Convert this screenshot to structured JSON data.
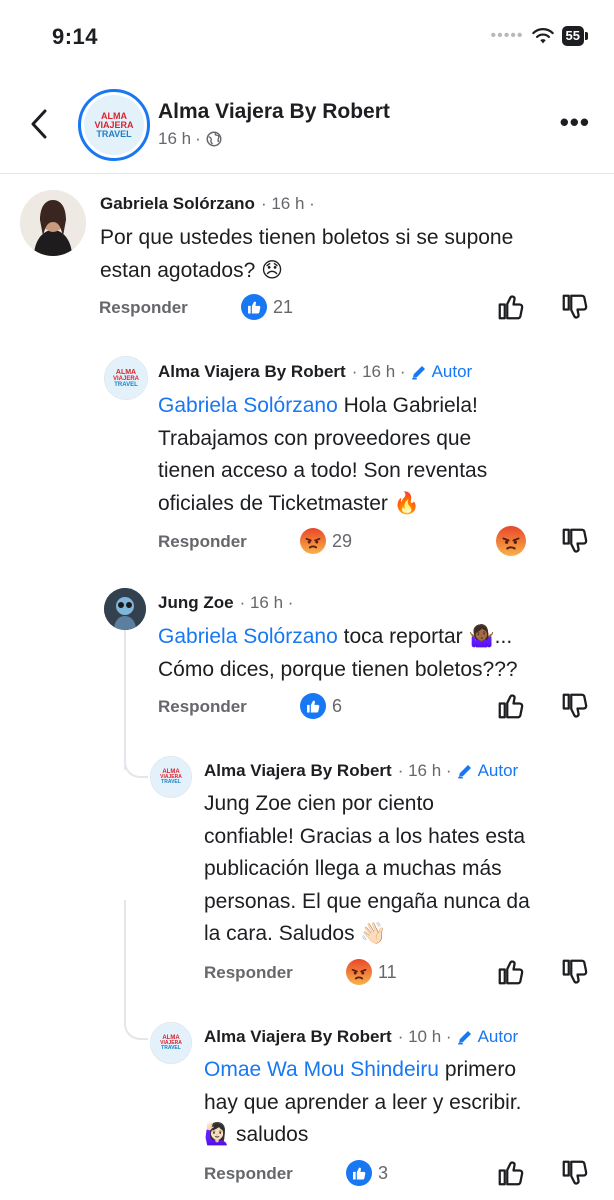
{
  "status_bar": {
    "time": "9:14",
    "battery": "55"
  },
  "header": {
    "title": "Alma Viajera By Robert",
    "time": "16 h",
    "separator": "·"
  },
  "logo": {
    "line1": "ALMA",
    "line2": "VIAJERA",
    "line3": "TRAVEL"
  },
  "comments": [
    {
      "author": "Gabriela Solórzano",
      "meta": "· 16 h ·",
      "text_lines": [
        "Por que ustedes tienen boletos si se supone",
        "estan agotados? 😞"
      ],
      "reply_label": "Responder",
      "reaction_count": "21",
      "reaction_type": "like"
    },
    {
      "author": "Alma Viajera By Robert",
      "meta": "· 16 h ·",
      "badge": "Autor",
      "mention": "Gabriela Solórzano",
      "text_lines": [
        " Hola Gabriela!",
        "Trabajamos con proveedores que",
        "tienen acceso a todo! Son reventas",
        "oficiales de Ticketmaster 🔥"
      ],
      "reply_label": "Responder",
      "reaction_count": "29",
      "reaction_type": "angry"
    },
    {
      "author": "Jung Zoe",
      "meta": "· 16 h ·",
      "mention": "Gabriela Solórzano",
      "text_lines": [
        " toca reportar 🤷🏾‍♀️...",
        "Cómo dices, porque tienen boletos???"
      ],
      "reply_label": "Responder",
      "reaction_count": "6",
      "reaction_type": "like"
    },
    {
      "author": "Alma Viajera By Robert",
      "meta": "· 16 h ·",
      "badge": "Autor",
      "text_lines": [
        "Jung Zoe cien por ciento",
        "confiable! Gracias a los hates esta",
        "publicación llega a muchas más",
        "personas. El que engaña nunca da",
        "la cara. Saludos 👋🏻"
      ],
      "reply_label": "Responder",
      "reaction_count": "11",
      "reaction_type": "angry"
    },
    {
      "author": "Alma Viajera By Robert",
      "meta": "· 10 h ·",
      "badge": "Autor",
      "mention": "Omae Wa Mou Shindeiru",
      "text_lines": [
        " primero",
        "hay que aprender a leer y escribir.",
        "🙋🏻‍♀️ saludos"
      ],
      "reply_label": "Responder",
      "reaction_count": "3",
      "reaction_type": "like"
    }
  ],
  "colors": {
    "accent": "#1877f2",
    "secondary_text": "#65676b",
    "angry": "#f25a28",
    "like": "#1877f2"
  }
}
